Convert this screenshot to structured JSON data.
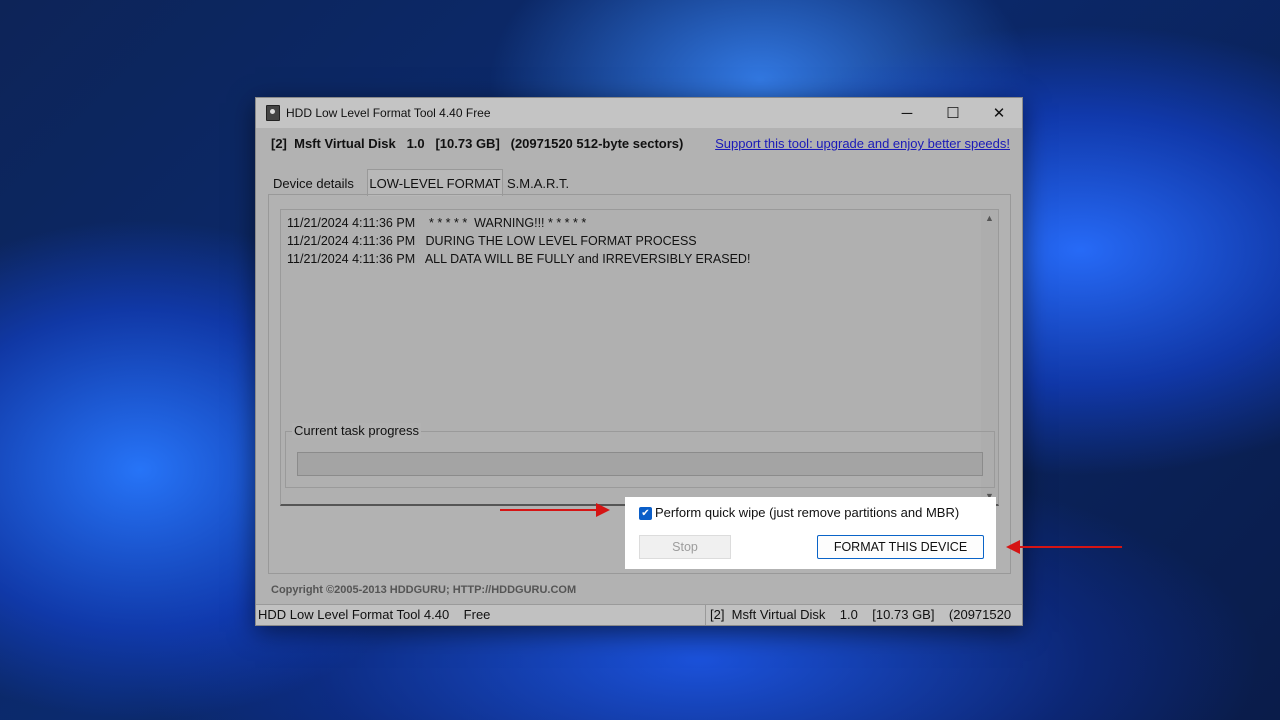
{
  "window": {
    "title": "HDD Low Level Format Tool 4.40   Free",
    "controls": {
      "minimize": "─",
      "maximize": "☐",
      "close": "✕"
    }
  },
  "device_line": "[2]  Msft Virtual Disk   1.0   [10.73 GB]   (20971520 512-byte sectors)",
  "support_link": "Support this tool: upgrade and enjoy better speeds!",
  "tabs": [
    {
      "label": "Device details"
    },
    {
      "label": "LOW-LEVEL FORMAT"
    },
    {
      "label": "S.M.A.R.T."
    }
  ],
  "log": {
    "lines": [
      "11/21/2024 4:11:36 PM    * * * * *  WARNING!!! * * * * *",
      "11/21/2024 4:11:36 PM   DURING THE LOW LEVEL FORMAT PROCESS",
      "11/21/2024 4:11:36 PM   ALL DATA WILL BE FULLY and IRREVERSIBLY ERASED!"
    ]
  },
  "progress": {
    "title": "Current task progress",
    "fraction": 0
  },
  "quick_wipe": {
    "checked": true,
    "label": "Perform quick wipe (just remove partitions and MBR)"
  },
  "buttons": {
    "stop": "Stop",
    "format": "FORMAT THIS DEVICE"
  },
  "copyright": "Copyright ©2005-2013 HDDGURU;   HTTP://HDDGURU.COM",
  "statusbar": {
    "left": "HDD Low Level Format Tool 4.40    Free",
    "right": "[2]  Msft Virtual Disk    1.0    [10.73 GB]    (20971520"
  },
  "colors": {
    "accent": "#0b5ec8",
    "arrow": "#d51414",
    "link": "#1a1ab8"
  }
}
